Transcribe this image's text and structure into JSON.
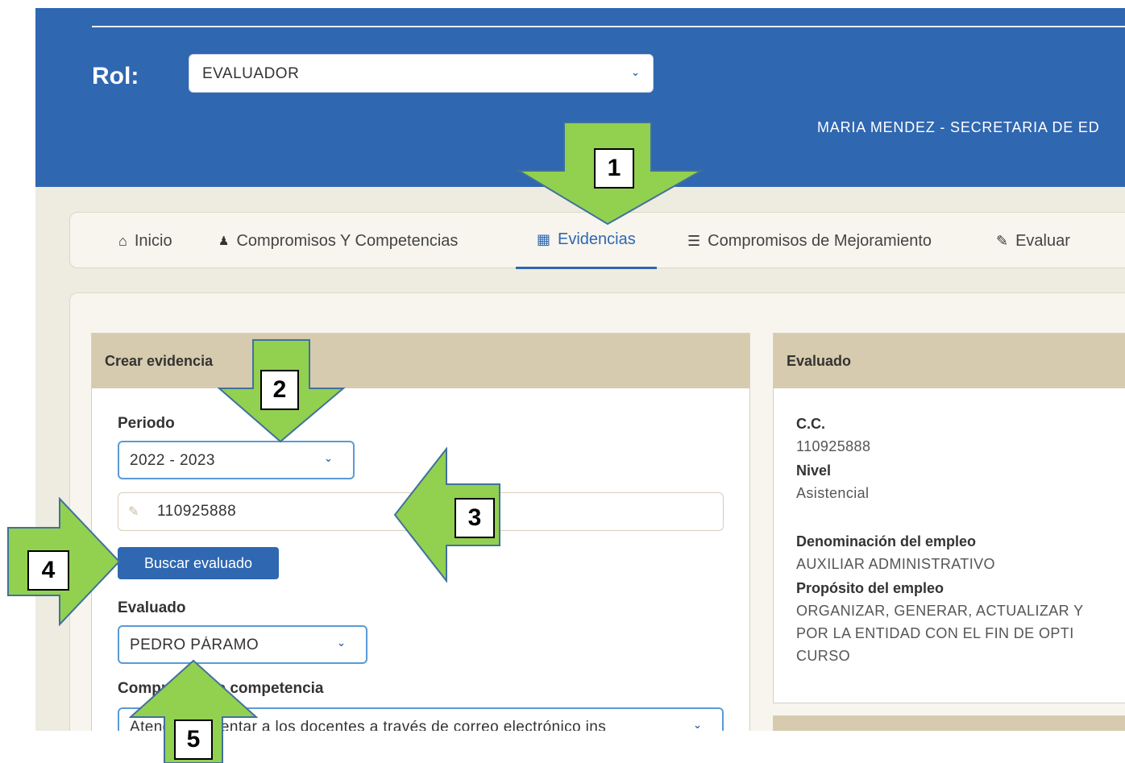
{
  "header": {
    "rol_label": "Rol:",
    "rol_value": "EVALUADOR",
    "user_info": "MARIA MENDEZ - SECRETARIA DE ED"
  },
  "tabs": [
    {
      "label": "Inicio",
      "icon": "home-icon"
    },
    {
      "label": "Compromisos Y Competencias",
      "icon": "handshake-icon"
    },
    {
      "label": "Evidencias",
      "icon": "save-icon",
      "active": true
    },
    {
      "label": "Compromisos de Mejoramiento",
      "icon": "list-icon"
    },
    {
      "label": "Evaluar",
      "icon": "edit-icon"
    }
  ],
  "crear": {
    "title": "Crear evidencia",
    "periodo_label": "Periodo",
    "periodo_value": "2022 - 2023",
    "cedula_value": "110925888",
    "buscar_label": "Buscar evaluado",
    "evaluado_label": "Evaluado",
    "evaluado_value": "PEDRO PÁRAMO",
    "compromiso_label": "Compromiso o competencia",
    "compromiso_value": "Atender y orientar a los docentes a través de correo electrónico ins"
  },
  "evaluado": {
    "title": "Evaluado",
    "cc_label": "C.C.",
    "cc_value": "110925888",
    "nivel_label": "Nivel",
    "nivel_value": "Asistencial",
    "denominacion_label": "Denominación del empleo",
    "denominacion_value": "AUXILIAR ADMINISTRATIVO",
    "proposito_label": "Propósito del empleo",
    "proposito_lines": [
      "ORGANIZAR, GENERAR, ACTUALIZAR Y",
      "POR LA ENTIDAD CON EL FIN DE OPTI",
      "CURSO"
    ]
  },
  "annotations": [
    "1",
    "2",
    "3",
    "4",
    "5"
  ],
  "colors": {
    "header_blue": "#2f67b1",
    "arrow_green": "#92d050",
    "card_head": "#d6cbae",
    "page_bg": "#eeebe0"
  }
}
